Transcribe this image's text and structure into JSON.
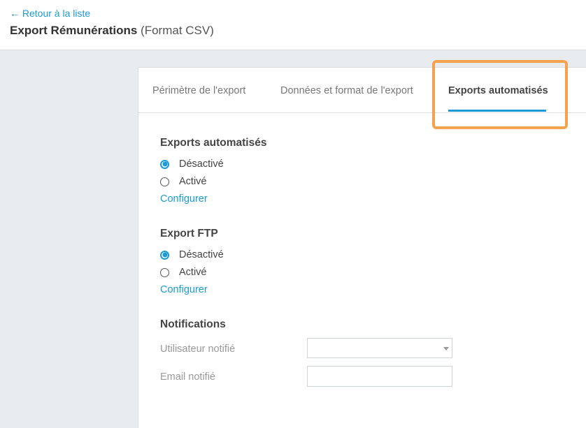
{
  "header": {
    "back_link": "← Retour à la liste",
    "title_bold": "Export Rémunérations",
    "title_light": "(Format CSV)"
  },
  "tabs": [
    {
      "label": "Périmètre de l'export",
      "active": false
    },
    {
      "label": "Données et format de l'export",
      "active": false
    },
    {
      "label": "Exports automatisés",
      "active": true
    }
  ],
  "sections": {
    "auto": {
      "title": "Exports automatisés",
      "options": [
        "Désactivé",
        "Activé"
      ],
      "selected": "Désactivé",
      "config_link": "Configurer"
    },
    "ftp": {
      "title": "Export FTP",
      "options": [
        "Désactivé",
        "Activé"
      ],
      "selected": "Désactivé",
      "config_link": "Configurer"
    },
    "notifications": {
      "title": "Notifications",
      "user_label": "Utilisateur notifié",
      "user_value": "",
      "email_label": "Email notifié",
      "email_value": ""
    }
  },
  "colors": {
    "accent": "#1a9ad6",
    "highlight": "#f5a24f",
    "background": "#e8ecef"
  }
}
